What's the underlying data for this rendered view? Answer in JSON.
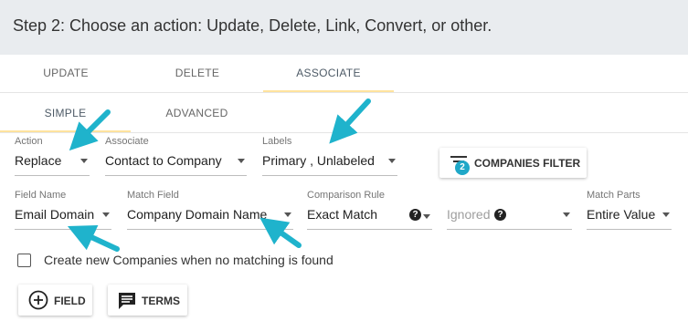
{
  "header": {
    "title": "Step 2: Choose an action: Update, Delete, Link, Convert, or other."
  },
  "tabs": {
    "update": "UPDATE",
    "delete": "DELETE",
    "associate": "ASSOCIATE"
  },
  "subtabs": {
    "simple": "SIMPLE",
    "advanced": "ADVANCED"
  },
  "row1": {
    "action_label": "Action",
    "action_value": "Replace",
    "associate_label": "Associate",
    "associate_value": "Contact to Company",
    "labels_label": "Labels",
    "labels_value": "Primary , Unlabeled",
    "filter_button": "COMPANIES FILTER",
    "filter_count": "2"
  },
  "row2": {
    "field_name_label": "Field Name",
    "field_name_value": "Email Domain",
    "match_field_label": "Match Field",
    "match_field_value": "Company Domain Name",
    "comparison_label": "Comparison Rule",
    "comparison_value": "Exact Match",
    "ignored_value": "Ignored",
    "match_parts_label": "Match Parts",
    "match_parts_value": "Entire Value"
  },
  "create_new": {
    "label": "Create new Companies when no matching is found",
    "checked": false
  },
  "buttons": {
    "field": "FIELD",
    "terms": "TERMS"
  },
  "colors": {
    "accent_arrow": "#1fb3cc",
    "tab_underline": "#ffe39e",
    "header_bg": "#e9ecef"
  }
}
